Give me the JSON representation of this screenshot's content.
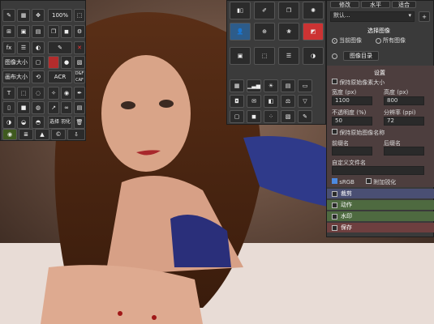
{
  "left_toolbar": {
    "percent": "100%",
    "resize": "图像大小",
    "canvas": "画布大小",
    "acr": "ACR",
    "dcaf": "D&F\nCAF",
    "select_feather": "选择\n羽化"
  },
  "top_right": {
    "btn1": "修改",
    "btn2": "水平",
    "btn3": "适合",
    "dropdown": "默认..."
  },
  "select_image": {
    "title": "选择图像",
    "opt_current": "当前图像",
    "opt_all": "所有图像",
    "folder_btn": "图像目录"
  },
  "settings": {
    "title": "设置",
    "keep_size": "保持原始像素大小",
    "width_label": "宽度 (px)",
    "width_value": "1100",
    "height_label": "高度 (px)",
    "height_value": "800",
    "opacity_label": "不透明度 (%)",
    "opacity_value": "50",
    "resolution_label": "分辨率 (ppi)",
    "resolution_value": "72",
    "keep_name": "保持原始图像名称",
    "prefix_label": "前缀名",
    "suffix_label": "后缀名",
    "custom_label": "自定义文件名",
    "srgb": "sRGB",
    "sharpen": "附加锐化"
  },
  "sections": [
    {
      "label": "裁剪",
      "color": "#4a4f73"
    },
    {
      "label": "动作",
      "color": "#4e6a40"
    },
    {
      "label": "水印",
      "color": "#4e6a40"
    },
    {
      "label": "保存",
      "color": "#6e3f3f"
    }
  ],
  "colors": {
    "panel": "#3b3b3b",
    "accent": "#2d5c8a"
  }
}
